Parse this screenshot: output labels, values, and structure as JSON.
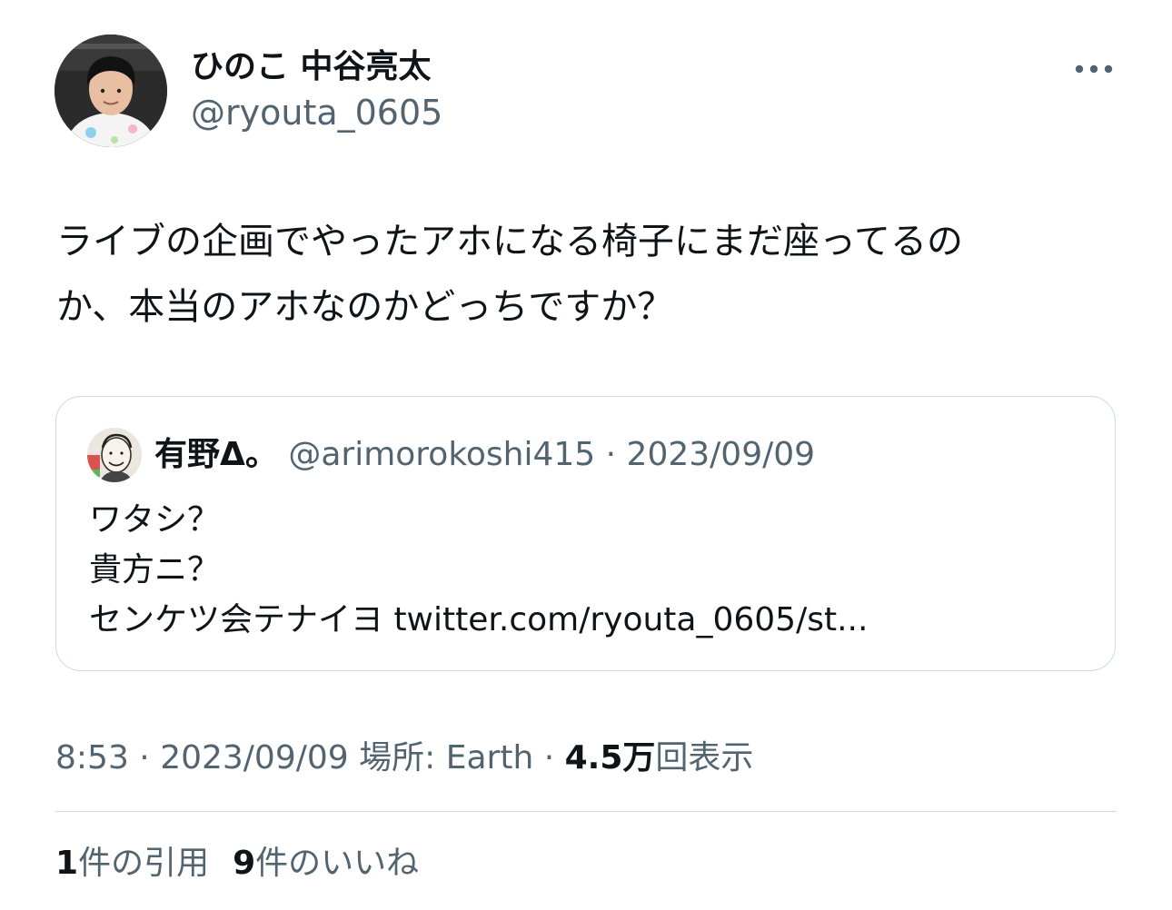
{
  "author": {
    "display_name": "ひのこ 中谷亮太",
    "handle": "@ryouta_0605"
  },
  "more_icon": "more-horizontal-icon",
  "tweet": {
    "text": "ライブの企画でやったアホになる椅子にまだ座ってるの\nか、本当のアホなのかどっちですか？"
  },
  "quote": {
    "display_name": "有野Δ。",
    "handle": "@arimorokoshi415",
    "separator": " · ",
    "date": "2023/09/09",
    "text": "ワタシ？\n貴方ニ？\nセンケツ会テナイヨ twitter.com/ryouta_0605/st..."
  },
  "meta": {
    "time": "8:53",
    "separator": " · ",
    "date": "2023/09/09",
    "location_label": "場所: ",
    "location": "Earth",
    "views_count": "4.5万",
    "views_label": "回表示"
  },
  "stats": {
    "quotes_count": "1",
    "quotes_label": "件の引用",
    "likes_count": "9",
    "likes_label": "件のいいね"
  },
  "colors": {
    "text": "#0f1419",
    "secondary": "#536471",
    "border": "#cfd9de"
  }
}
